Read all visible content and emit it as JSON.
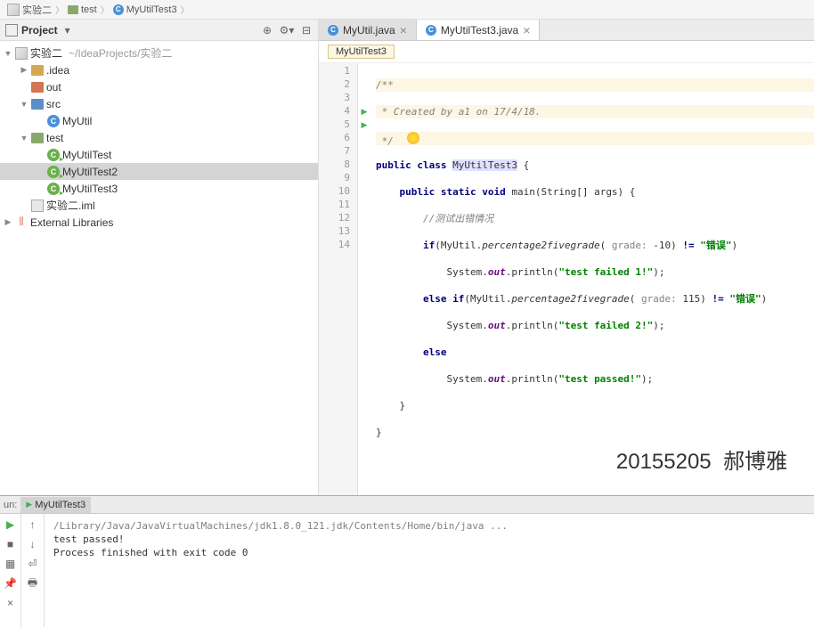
{
  "breadcrumb": {
    "project": "实验二",
    "folder": "test",
    "file": "MyUtilTest3"
  },
  "sidebar": {
    "title": "Project",
    "root": "实验二",
    "root_path": "~/IdeaProjects/实验二",
    "items": {
      "idea": ".idea",
      "out": "out",
      "src": "src",
      "myutil": "MyUtil",
      "test": "test",
      "test1": "MyUtilTest",
      "test2": "MyUtilTest2",
      "test3": "MyUtilTest3",
      "iml": "实验二.iml",
      "external": "External Libraries"
    }
  },
  "tabs": {
    "tab1": "MyUtil.java",
    "tab2": "MyUtilTest3.java"
  },
  "crumb": "MyUtilTest3",
  "code": {
    "l1": "/**",
    "l2": " * Created by a1 on 17/4/18.",
    "l3": " */",
    "l4_kw1": "public class ",
    "l4_cls": "MyUtilTest3",
    "l4_brace": " {",
    "l5_kw": "public static void ",
    "l5_name": "main",
    "l5_sig": "(String[] args) {",
    "l6": "//测试出错情况",
    "l7_if": "if",
    "l7_a": "(MyUtil.",
    "l7_m": "percentage2fivegrade",
    "l7_b": "( ",
    "l7_p": "grade: ",
    "l7_v": "-10",
    "l7_c": ") ",
    "l7_ne": "!= ",
    "l7_s": "\"错误\"",
    "l7_d": ")",
    "l8_a": "System.",
    "l8_out": "out",
    "l8_b": ".println(",
    "l8_s": "\"test failed 1!\"",
    "l8_c": ");",
    "l9_kw": "else if",
    "l9_a": "(MyUtil.",
    "l9_m": "percentage2fivegrade",
    "l9_b": "( ",
    "l9_p": "grade: ",
    "l9_v": "115",
    "l9_c": ") ",
    "l9_ne": "!= ",
    "l9_s": "\"错误\"",
    "l9_d": ")",
    "l10_a": "System.",
    "l10_out": "out",
    "l10_b": ".println(",
    "l10_s": "\"test failed 2!\"",
    "l10_c": ");",
    "l11": "else",
    "l12_a": "System.",
    "l12_out": "out",
    "l12_b": ".println(",
    "l12_s": "\"test passed!\"",
    "l12_c": ");",
    "l13": "}",
    "l14": "}"
  },
  "lines": {
    "l1": "1",
    "l2": "2",
    "l3": "3",
    "l4": "4",
    "l5": "5",
    "l6": "6",
    "l7": "7",
    "l8": "8",
    "l9": "9",
    "l10": "10",
    "l11": "11",
    "l12": "12",
    "l13": "13",
    "l14": "14"
  },
  "watermark": "20155205  郝博雅",
  "run": {
    "label": "un:",
    "config": "MyUtilTest3",
    "cmd": "/Library/Java/JavaVirtualMachines/jdk1.8.0_121.jdk/Contents/Home/bin/java ...",
    "out1": "test passed!",
    "out2": "",
    "out3": "Process finished with exit code 0"
  }
}
